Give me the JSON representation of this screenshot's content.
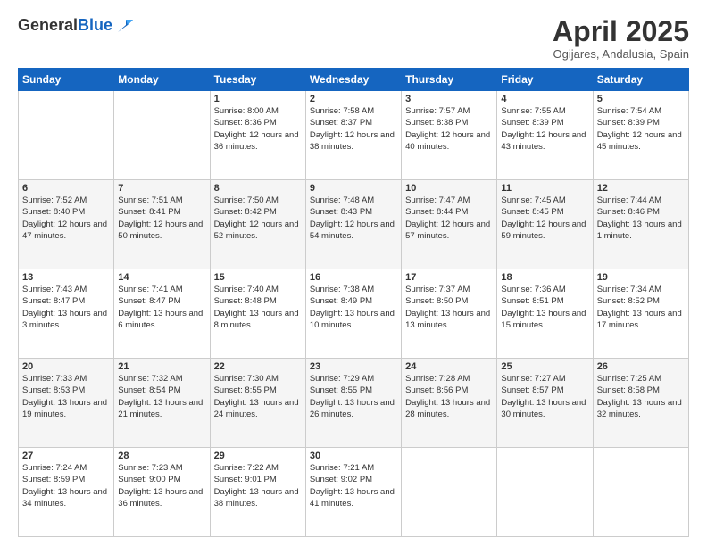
{
  "header": {
    "logo_general": "General",
    "logo_blue": "Blue",
    "month_title": "April 2025",
    "subtitle": "Ogijares, Andalusia, Spain"
  },
  "columns": [
    "Sunday",
    "Monday",
    "Tuesday",
    "Wednesday",
    "Thursday",
    "Friday",
    "Saturday"
  ],
  "weeks": [
    [
      {
        "day": "",
        "info": ""
      },
      {
        "day": "",
        "info": ""
      },
      {
        "day": "1",
        "info": "Sunrise: 8:00 AM\nSunset: 8:36 PM\nDaylight: 12 hours and 36 minutes."
      },
      {
        "day": "2",
        "info": "Sunrise: 7:58 AM\nSunset: 8:37 PM\nDaylight: 12 hours and 38 minutes."
      },
      {
        "day": "3",
        "info": "Sunrise: 7:57 AM\nSunset: 8:38 PM\nDaylight: 12 hours and 40 minutes."
      },
      {
        "day": "4",
        "info": "Sunrise: 7:55 AM\nSunset: 8:39 PM\nDaylight: 12 hours and 43 minutes."
      },
      {
        "day": "5",
        "info": "Sunrise: 7:54 AM\nSunset: 8:39 PM\nDaylight: 12 hours and 45 minutes."
      }
    ],
    [
      {
        "day": "6",
        "info": "Sunrise: 7:52 AM\nSunset: 8:40 PM\nDaylight: 12 hours and 47 minutes."
      },
      {
        "day": "7",
        "info": "Sunrise: 7:51 AM\nSunset: 8:41 PM\nDaylight: 12 hours and 50 minutes."
      },
      {
        "day": "8",
        "info": "Sunrise: 7:50 AM\nSunset: 8:42 PM\nDaylight: 12 hours and 52 minutes."
      },
      {
        "day": "9",
        "info": "Sunrise: 7:48 AM\nSunset: 8:43 PM\nDaylight: 12 hours and 54 minutes."
      },
      {
        "day": "10",
        "info": "Sunrise: 7:47 AM\nSunset: 8:44 PM\nDaylight: 12 hours and 57 minutes."
      },
      {
        "day": "11",
        "info": "Sunrise: 7:45 AM\nSunset: 8:45 PM\nDaylight: 12 hours and 59 minutes."
      },
      {
        "day": "12",
        "info": "Sunrise: 7:44 AM\nSunset: 8:46 PM\nDaylight: 13 hours and 1 minute."
      }
    ],
    [
      {
        "day": "13",
        "info": "Sunrise: 7:43 AM\nSunset: 8:47 PM\nDaylight: 13 hours and 3 minutes."
      },
      {
        "day": "14",
        "info": "Sunrise: 7:41 AM\nSunset: 8:47 PM\nDaylight: 13 hours and 6 minutes."
      },
      {
        "day": "15",
        "info": "Sunrise: 7:40 AM\nSunset: 8:48 PM\nDaylight: 13 hours and 8 minutes."
      },
      {
        "day": "16",
        "info": "Sunrise: 7:38 AM\nSunset: 8:49 PM\nDaylight: 13 hours and 10 minutes."
      },
      {
        "day": "17",
        "info": "Sunrise: 7:37 AM\nSunset: 8:50 PM\nDaylight: 13 hours and 13 minutes."
      },
      {
        "day": "18",
        "info": "Sunrise: 7:36 AM\nSunset: 8:51 PM\nDaylight: 13 hours and 15 minutes."
      },
      {
        "day": "19",
        "info": "Sunrise: 7:34 AM\nSunset: 8:52 PM\nDaylight: 13 hours and 17 minutes."
      }
    ],
    [
      {
        "day": "20",
        "info": "Sunrise: 7:33 AM\nSunset: 8:53 PM\nDaylight: 13 hours and 19 minutes."
      },
      {
        "day": "21",
        "info": "Sunrise: 7:32 AM\nSunset: 8:54 PM\nDaylight: 13 hours and 21 minutes."
      },
      {
        "day": "22",
        "info": "Sunrise: 7:30 AM\nSunset: 8:55 PM\nDaylight: 13 hours and 24 minutes."
      },
      {
        "day": "23",
        "info": "Sunrise: 7:29 AM\nSunset: 8:55 PM\nDaylight: 13 hours and 26 minutes."
      },
      {
        "day": "24",
        "info": "Sunrise: 7:28 AM\nSunset: 8:56 PM\nDaylight: 13 hours and 28 minutes."
      },
      {
        "day": "25",
        "info": "Sunrise: 7:27 AM\nSunset: 8:57 PM\nDaylight: 13 hours and 30 minutes."
      },
      {
        "day": "26",
        "info": "Sunrise: 7:25 AM\nSunset: 8:58 PM\nDaylight: 13 hours and 32 minutes."
      }
    ],
    [
      {
        "day": "27",
        "info": "Sunrise: 7:24 AM\nSunset: 8:59 PM\nDaylight: 13 hours and 34 minutes."
      },
      {
        "day": "28",
        "info": "Sunrise: 7:23 AM\nSunset: 9:00 PM\nDaylight: 13 hours and 36 minutes."
      },
      {
        "day": "29",
        "info": "Sunrise: 7:22 AM\nSunset: 9:01 PM\nDaylight: 13 hours and 38 minutes."
      },
      {
        "day": "30",
        "info": "Sunrise: 7:21 AM\nSunset: 9:02 PM\nDaylight: 13 hours and 41 minutes."
      },
      {
        "day": "",
        "info": ""
      },
      {
        "day": "",
        "info": ""
      },
      {
        "day": "",
        "info": ""
      }
    ]
  ]
}
